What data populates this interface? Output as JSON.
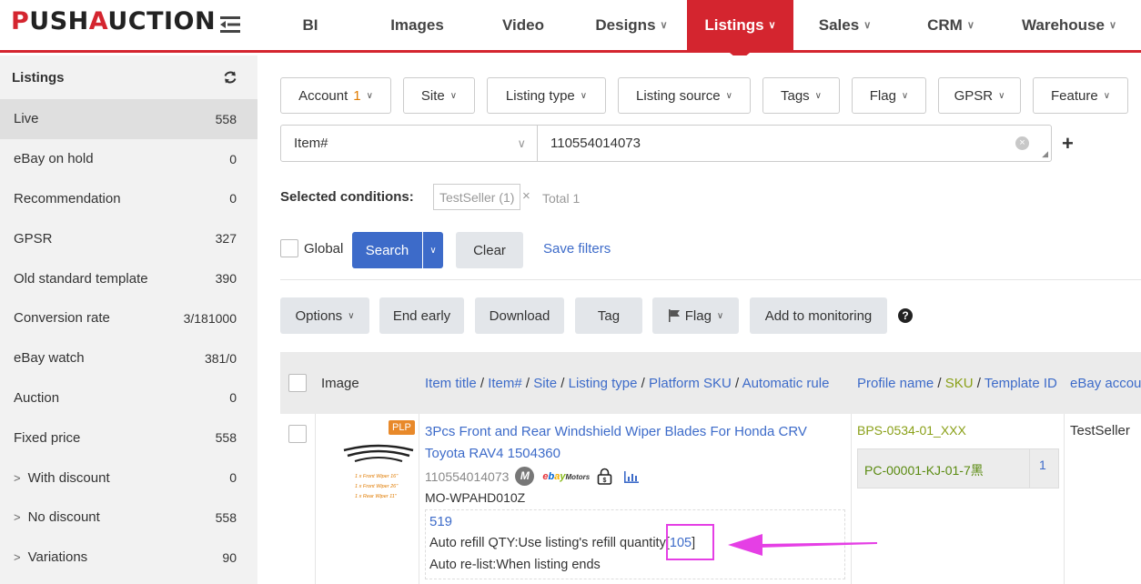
{
  "brand": {
    "logo_text": "PUSHAUCTION"
  },
  "nav": [
    {
      "label": "BI",
      "caret": false
    },
    {
      "label": "Images",
      "caret": false
    },
    {
      "label": "Video",
      "caret": false
    },
    {
      "label": "Designs",
      "caret": true
    },
    {
      "label": "Listings",
      "caret": true,
      "active": true
    },
    {
      "label": "Sales",
      "caret": true
    },
    {
      "label": "CRM",
      "caret": true
    },
    {
      "label": "Warehouse",
      "caret": true
    }
  ],
  "sidebar": {
    "title": "Listings",
    "items": [
      {
        "label": "Live",
        "count": "558",
        "active": true
      },
      {
        "label": "eBay on hold",
        "count": "0"
      },
      {
        "label": "Recommendation",
        "count": "0"
      },
      {
        "label": "GPSR",
        "count": "327"
      },
      {
        "label": "Old standard template",
        "count": "390"
      },
      {
        "label": "Conversion rate",
        "count": "3/181000"
      },
      {
        "label": "eBay watch",
        "count": "381/0"
      },
      {
        "label": "Auction",
        "count": "0"
      },
      {
        "label": "Fixed price",
        "count": "558"
      },
      {
        "label": "With discount",
        "count": "0",
        "expandable": true
      },
      {
        "label": "No discount",
        "count": "558",
        "expandable": true
      },
      {
        "label": "Variations",
        "count": "90",
        "expandable": true
      }
    ]
  },
  "filters": [
    {
      "label": "Account",
      "badge": "1"
    },
    {
      "label": "Site"
    },
    {
      "label": "Listing type"
    },
    {
      "label": "Listing source"
    },
    {
      "label": "Tags"
    },
    {
      "label": "Flag"
    },
    {
      "label": "GPSR"
    },
    {
      "label": "Feature"
    }
  ],
  "search": {
    "field": "Item#",
    "value": "110554014073"
  },
  "conditions": {
    "label": "Selected conditions:",
    "tag": "TestSeller (1)",
    "total": "Total 1"
  },
  "controls": {
    "global": "Global",
    "search": "Search",
    "clear": "Clear",
    "save_filters": "Save filters"
  },
  "actions": {
    "options": "Options",
    "end_early": "End early",
    "download": "Download",
    "tag": "Tag",
    "flag": "Flag",
    "add_monitoring": "Add to monitoring",
    "help": "?"
  },
  "table": {
    "headers": {
      "image": "Image",
      "title_parts": [
        "Item title",
        "Item#",
        "Site",
        "Listing type",
        "Platform SKU",
        "Automatic rule"
      ],
      "profile_parts": [
        "Profile name",
        "SKU",
        "Template ID"
      ],
      "ebay_account": "eBay accou"
    },
    "rows": [
      {
        "badge": "PLP",
        "title": "3Pcs Front and Rear Windshield Wiper Blades For Honda CRV Toyota RAV4 1504360",
        "item_id": "110554014073",
        "motors": "ebay Motors",
        "sku": "MO-WPAHD010Z",
        "qty": "519",
        "auto_refill_prefix": "Auto refill QTY:Use listing's refill quantity[",
        "auto_refill_num": "105",
        "auto_refill_suffix": "]",
        "auto_relist": "Auto re-list:When listing ends",
        "thumb_lines": [
          "1 x Front Wiper 16\"",
          "1 x Front Wiper 26\"",
          "1 x Rear Wiper 11\""
        ],
        "profile": "BPS-0534-01_XXX",
        "sku_code": "PC-00001-KJ-01-7黑",
        "sku_qty": "1",
        "account": "TestSeller"
      }
    ]
  },
  "colors": {
    "brand_red": "#d4252f",
    "link_blue": "#3d6bc9",
    "highlight": "#e53fe5"
  }
}
